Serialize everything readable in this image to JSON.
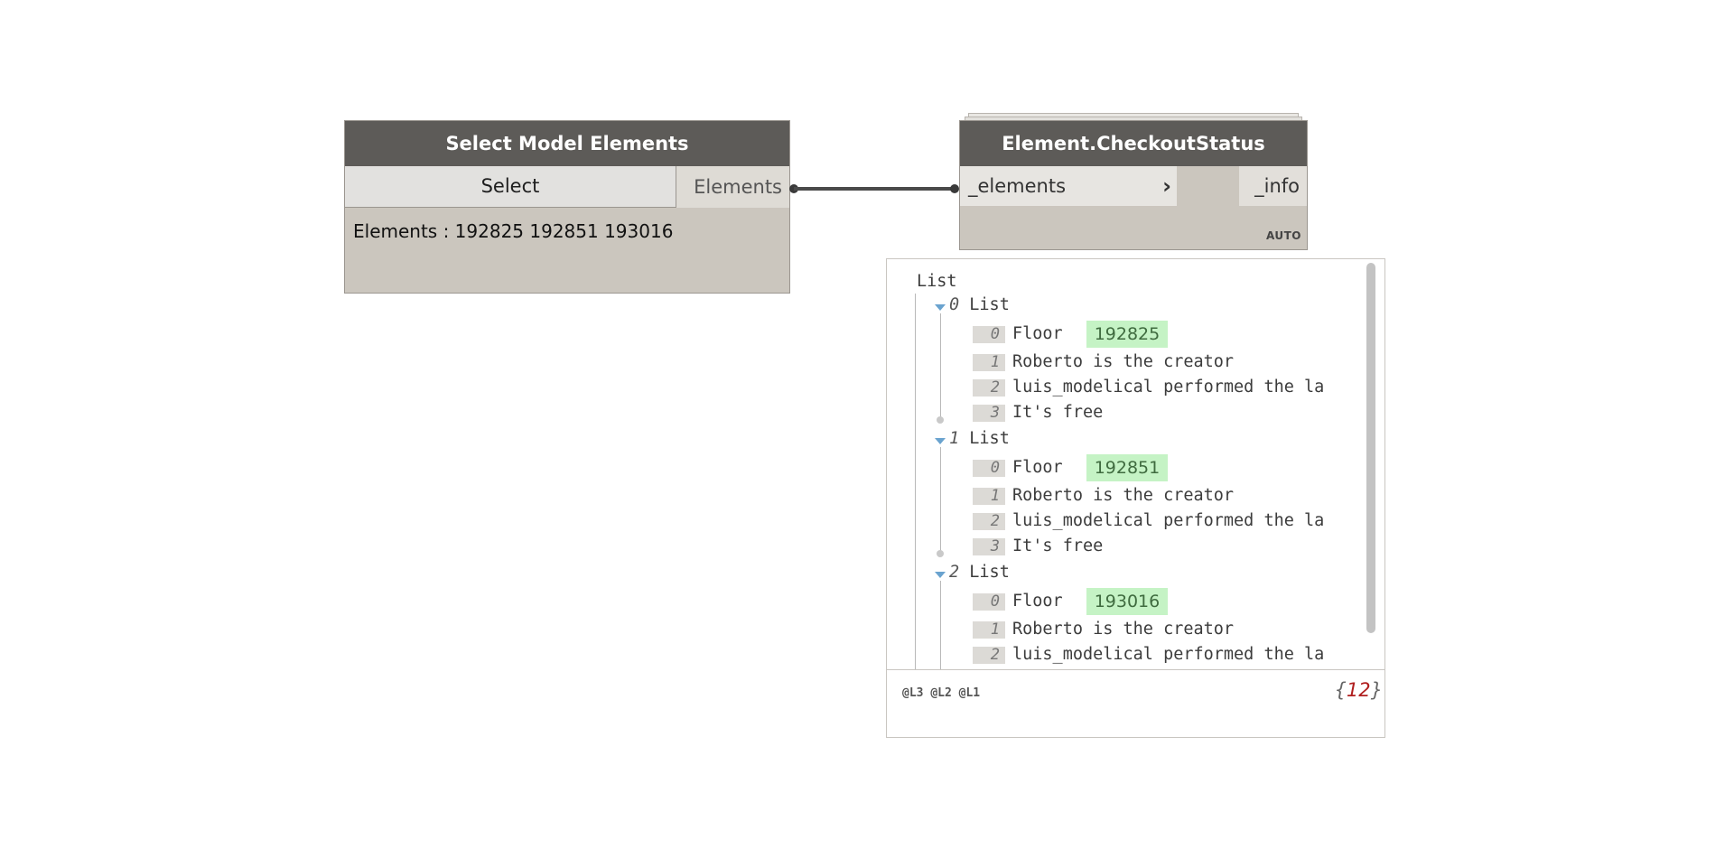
{
  "select_node": {
    "title": "Select Model Elements",
    "button_label": "Select",
    "output_port": "Elements",
    "info_text": "Elements : 192825 192851 193016"
  },
  "checkout_node": {
    "title": "Element.CheckoutStatus",
    "input_port": "_elements",
    "input_chevron": "›",
    "output_port": "_info",
    "lacing": "AUTO"
  },
  "preview": {
    "root_label": "List",
    "lists": [
      {
        "index": "0",
        "label": "List",
        "items": [
          {
            "index": "0",
            "text": "Floor",
            "element_id": "192825"
          },
          {
            "index": "1",
            "text": "Roberto is the creator"
          },
          {
            "index": "2",
            "text": "luis_modelical performed the la"
          },
          {
            "index": "3",
            "text": "It's free"
          }
        ]
      },
      {
        "index": "1",
        "label": "List",
        "items": [
          {
            "index": "0",
            "text": "Floor",
            "element_id": "192851"
          },
          {
            "index": "1",
            "text": "Roberto is the creator"
          },
          {
            "index": "2",
            "text": "luis_modelical performed the la"
          },
          {
            "index": "3",
            "text": "It's free"
          }
        ]
      },
      {
        "index": "2",
        "label": "List",
        "items": [
          {
            "index": "0",
            "text": "Floor",
            "element_id": "193016"
          },
          {
            "index": "1",
            "text": "Roberto is the creator"
          },
          {
            "index": "2",
            "text": "luis_modelical performed the la"
          }
        ]
      }
    ],
    "levels": [
      "@L3",
      "@L2",
      "@L1"
    ],
    "count_open": "{",
    "count": "12",
    "count_close": "}"
  },
  "colors": {
    "node_header": "#5d5b58",
    "node_body": "#cbc6be",
    "element_badge": "#c5f3c5",
    "count_number": "#b01e1e",
    "expander": "#6aa3cf"
  },
  "icons": {
    "expander": "triangle-down-icon",
    "input_chevron": "chevron-right-icon"
  }
}
